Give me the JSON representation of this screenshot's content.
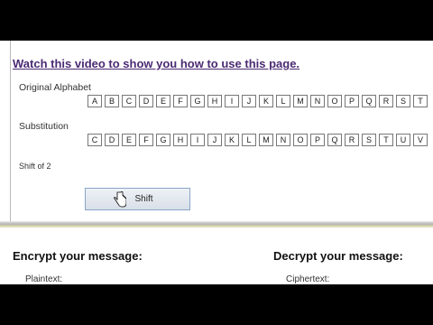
{
  "video_link": "Watch this video to show you how to use this page.",
  "original": {
    "label": "Original Alphabet",
    "letters": [
      "A",
      "B",
      "C",
      "D",
      "E",
      "F",
      "G",
      "H",
      "I",
      "J",
      "K",
      "L",
      "M",
      "N",
      "O",
      "P",
      "Q",
      "R",
      "S",
      "T"
    ]
  },
  "substitution": {
    "label": "Substitution",
    "letters": [
      "C",
      "D",
      "E",
      "F",
      "G",
      "H",
      "I",
      "J",
      "K",
      "L",
      "M",
      "N",
      "O",
      "P",
      "Q",
      "R",
      "S",
      "T",
      "U",
      "V"
    ]
  },
  "shift": {
    "label": "Shift of 2",
    "button_label": "Shift"
  },
  "encrypt": {
    "title": "Encrypt your message:",
    "field_label": "Plaintext:"
  },
  "decrypt": {
    "title": "Decrypt your message:",
    "field_label": "Ciphertext:"
  }
}
